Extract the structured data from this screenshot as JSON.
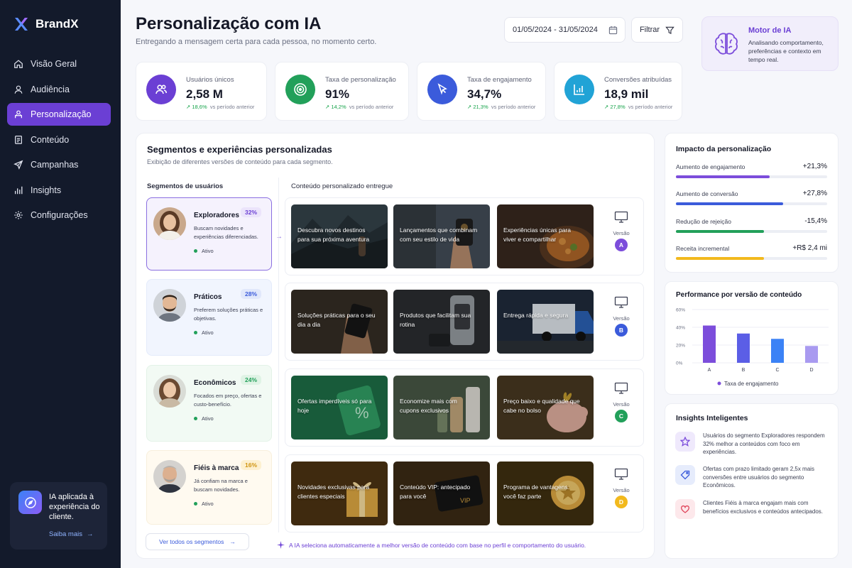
{
  "brand": {
    "name": "BrandX"
  },
  "sidebar": {
    "items": [
      {
        "label": "Visão Geral",
        "icon": "home-icon"
      },
      {
        "label": "Audiência",
        "icon": "user-icon"
      },
      {
        "label": "Personalização",
        "icon": "personalize-icon",
        "active": true
      },
      {
        "label": "Conteúdo",
        "icon": "document-icon"
      },
      {
        "label": "Campanhas",
        "icon": "send-icon"
      },
      {
        "label": "Insights",
        "icon": "bar-chart-icon"
      },
      {
        "label": "Configurações",
        "icon": "gear-icon"
      }
    ],
    "promo": {
      "text": "IA aplicada à experiência do cliente.",
      "link": "Saiba mais"
    }
  },
  "header": {
    "title": "Personalização com IA",
    "subtitle": "Entregando a mensagem certa para cada pessoa, no momento certo.",
    "date_range": "01/05/2024 - 31/05/2024",
    "filter_label": "Filtrar"
  },
  "engine": {
    "title": "Motor de IA",
    "description": "Analisando comportamento, preferências e contexto em tempo real."
  },
  "kpis": [
    {
      "label": "Usuários únicos",
      "value": "2,58 M",
      "delta": "18,6%",
      "delta_note": "vs período anterior",
      "color": "#6b3fd4",
      "icon": "users-icon"
    },
    {
      "label": "Taxa de personalização",
      "value": "91%",
      "delta": "14,2%",
      "delta_note": "vs período anterior",
      "color": "#22a05a",
      "icon": "target-icon"
    },
    {
      "label": "Taxa de engajamento",
      "value": "34,7%",
      "delta": "21,3%",
      "delta_note": "vs período anterior",
      "color": "#3b5bdb",
      "icon": "cursor-icon"
    },
    {
      "label": "Conversões atribuídas",
      "value": "18,9 mil",
      "delta": "27,8%",
      "delta_note": "vs período anterior",
      "color": "#21a3d6",
      "icon": "growth-chart-icon"
    }
  ],
  "segments_section": {
    "title": "Segmentos e experiências personalizadas",
    "subtitle": "Exibição de diferentes versões de conteúdo para cada segmento.",
    "segments_header": "Segmentos de usuários",
    "content_header": "Conteúdo personalizado entregue",
    "version_label": "Versão",
    "view_all": "Ver todos os segmentos",
    "footnote": "A IA seleciona automaticamente a melhor versão de conteúdo com base no perfil e comportamento do usuário.",
    "segments": [
      {
        "name": "Exploradores",
        "pct": "32%",
        "desc": "Buscam novidades e experiências diferenciadas.",
        "status": "Ativo",
        "version": "A",
        "color": "#7c4ddb",
        "tiles": [
          "Descubra novos destinos para sua próxima aventura",
          "Lançamentos que combinam com seu estilo de vida",
          "Experiências únicas para viver e compartilhar"
        ]
      },
      {
        "name": "Práticos",
        "pct": "28%",
        "desc": "Preferem soluções práticas e objetivas.",
        "status": "Ativo",
        "version": "B",
        "color": "#3b5bdb",
        "tiles": [
          "Soluções práticas para o seu dia a dia",
          "Produtos que facilitam sua rotina",
          "Entrega rápida e segura"
        ]
      },
      {
        "name": "Econômicos",
        "pct": "24%",
        "desc": "Focados em preço, ofertas e custo-benefício.",
        "status": "Ativo",
        "version": "C",
        "color": "#22a05a",
        "tiles": [
          "Ofertas imperdíveis só para hoje",
          "Economize mais com cupons exclusivos",
          "Preço baixo e qualidade que cabe no bolso"
        ]
      },
      {
        "name": "Fiéis à marca",
        "pct": "16%",
        "desc": "Já confiam na marca e buscam novidades.",
        "status": "Ativo",
        "version": "D",
        "color": "#e5a812",
        "tiles": [
          "Novidades exclusivas para clientes especiais",
          "Conteúdo VIP: antecipado para você",
          "Programa de vantagens: você faz parte"
        ]
      }
    ]
  },
  "impact": {
    "title": "Impacto da personalização",
    "metrics": [
      {
        "label": "Aumento de engajamento",
        "value": "+21,3%",
        "fill": 0.62,
        "color": "#7c4ddb"
      },
      {
        "label": "Aumento de conversão",
        "value": "+27,8%",
        "fill": 0.71,
        "color": "#3b5bdb"
      },
      {
        "label": "Redução de rejeição",
        "value": "-15,4%",
        "fill": 0.58,
        "color": "#22a05a"
      },
      {
        "label": "Receita incremental",
        "value": "+R$ 2,4 mi",
        "fill": 0.58,
        "color": "#f2b91d"
      }
    ]
  },
  "performance": {
    "title": "Performance por versão de conteúdo",
    "legend": "Taxa de engajamento"
  },
  "chart_data": {
    "type": "bar",
    "categories": [
      "A",
      "B",
      "C",
      "D"
    ],
    "values": [
      42,
      33,
      27,
      19
    ],
    "colors": [
      "#7c4ddb",
      "#5b5ee6",
      "#3b82f6",
      "#a99af0"
    ],
    "yticks": [
      "0%",
      "20%",
      "40%",
      "60%"
    ],
    "ylim": [
      0,
      60
    ],
    "title": "Performance por versão de conteúdo",
    "xlabel": "",
    "ylabel": "",
    "legend": "Taxa de engajamento",
    "grid": true
  },
  "insights": {
    "title": "Insights Inteligentes",
    "items": [
      {
        "text": "Usuários do segmento Exploradores respondem 32% melhor a conteúdos com foco em experiências.",
        "icon": "star-icon",
        "color": "#7c4ddb"
      },
      {
        "text": "Ofertas com prazo limitado geram 2,5x mais conversões entre usuários do segmento Econômicos.",
        "icon": "tag-icon",
        "color": "#3b5bdb"
      },
      {
        "text": "Clientes Fiéis à marca engajam mais com benefícios exclusivos e conteúdos antecipados.",
        "icon": "heart-icon",
        "color": "#e0455b"
      }
    ]
  }
}
